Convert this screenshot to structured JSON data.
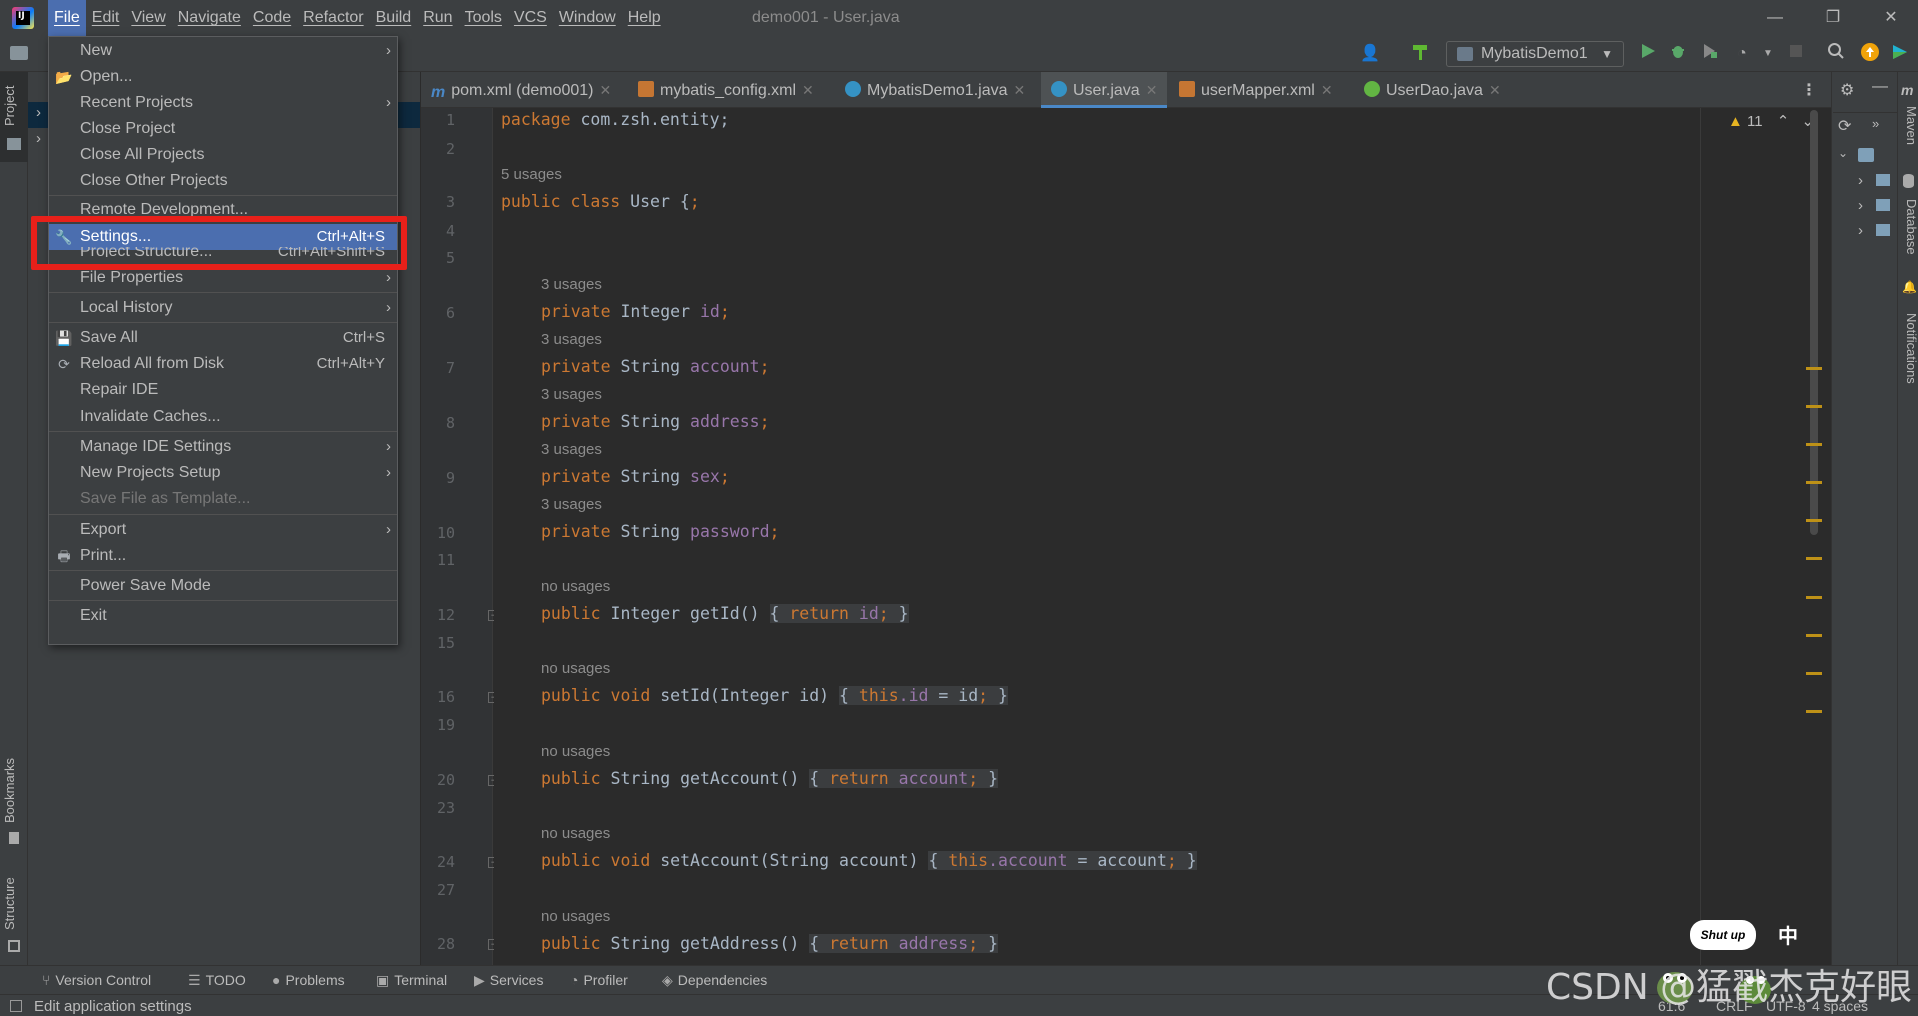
{
  "window": {
    "title": "demo001 - User.java",
    "minimize": "—",
    "maximize": "❐",
    "close": "✕"
  },
  "menubar": [
    "File",
    "Edit",
    "View",
    "Navigate",
    "Code",
    "Refactor",
    "Build",
    "Run",
    "Tools",
    "VCS",
    "Window",
    "Help"
  ],
  "toolbar": {
    "run_config": "MybatisDemo1"
  },
  "left_strip": {
    "project": "Project",
    "bookmarks": "Bookmarks",
    "structure": "Structure"
  },
  "right_strip": {
    "maven": "Maven",
    "database": "Database",
    "notifications": "Notifications"
  },
  "tabs": [
    {
      "label": "pom.xml (demo001)",
      "icon": "maven-icon"
    },
    {
      "label": "mybatis_config.xml",
      "icon": "xml-icon"
    },
    {
      "label": "MybatisDemo1.java",
      "icon": "class-icon"
    },
    {
      "label": "User.java",
      "icon": "class-icon",
      "active": true
    },
    {
      "label": "userMapper.xml",
      "icon": "xml-icon"
    },
    {
      "label": "UserDao.java",
      "icon": "interface-icon"
    }
  ],
  "editor": {
    "inspection_count": "11",
    "line_numbers": [
      "1",
      "2",
      "3",
      "4",
      "5",
      "6",
      "7",
      "8",
      "9",
      "10",
      "11",
      "12",
      "15",
      "16",
      "19",
      "20",
      "23",
      "24",
      "27",
      "28"
    ],
    "hints": {
      "class_usages": "5 usages",
      "field_usages": "3 usages",
      "no_usages": "no usages"
    },
    "code": {
      "package_kw": "package",
      "package_name": " com.zsh.entity;",
      "class_line_kw": "public class",
      "class_name": " User {",
      "private": "private",
      "f_id_type": " Integer ",
      "f_id": "id",
      "f_account_type": " String ",
      "f_account": "account",
      "f_address_type": " String ",
      "f_address": "address",
      "f_sex_type": " String ",
      "f_sex": "sex",
      "f_password_type": " String ",
      "f_password": "password",
      "semicolon": ";",
      "m1_kw": "public",
      "m1_type": " Integer ",
      "m1_name": "getId",
      "m1_params": "()",
      "m1_body_kw": "return",
      "m1_body_fld": " id",
      "m2_kw": "public void",
      "m2_name": " setId",
      "m2_params": "(Integer id)",
      "m2_this": "this",
      "m2_fld": ".id",
      "m2_rest": " = id",
      "m3_kw": "public",
      "m3_type": " String ",
      "m3_name": "getAccount",
      "m3_params": "()",
      "m3_body_kw": "return",
      "m3_body_fld": " account",
      "m4_kw": "public void",
      "m4_name": " setAccount",
      "m4_params": "(String account)",
      "m4_this": "this",
      "m4_fld": ".account",
      "m4_rest": " = account",
      "m5_kw": "public",
      "m5_type": " String ",
      "m5_name": "getAddress",
      "m5_params": "()",
      "m5_body_kw": "return",
      "m5_body_fld": " address"
    }
  },
  "file_menu": {
    "items": [
      {
        "label": "New",
        "submenu": true
      },
      {
        "label": "Open...",
        "icon": "folder-open-icon"
      },
      {
        "label": "Recent Projects",
        "submenu": true
      },
      {
        "label": "Close Project"
      },
      {
        "label": "Close All Projects"
      },
      {
        "label": "Close Other Projects"
      },
      {
        "label": "Remote Development..."
      },
      {
        "label": "Settings...",
        "shortcut": "Ctrl+Alt+S",
        "icon": "wrench-icon",
        "selected": true
      },
      {
        "label": "Project Structure...",
        "shortcut": "Ctrl+Alt+Shift+S",
        "icon": "folder-icon"
      },
      {
        "label": "File Properties",
        "submenu": true
      },
      {
        "label": "Local History",
        "submenu": true
      },
      {
        "label": "Save All",
        "shortcut": "Ctrl+S",
        "icon": "save-icon"
      },
      {
        "label": "Reload All from Disk",
        "shortcut": "Ctrl+Alt+Y",
        "icon": "reload-icon"
      },
      {
        "label": "Repair IDE"
      },
      {
        "label": "Invalidate Caches..."
      },
      {
        "label": "Manage IDE Settings",
        "submenu": true
      },
      {
        "label": "New Projects Setup",
        "submenu": true
      },
      {
        "label": "Save File as Template...",
        "disabled": true
      },
      {
        "label": "Export",
        "submenu": true
      },
      {
        "label": "Print...",
        "icon": "print-icon"
      },
      {
        "label": "Power Save Mode"
      },
      {
        "label": "Exit"
      }
    ]
  },
  "bottom_tools": [
    "Version Control",
    "TODO",
    "Problems",
    "Terminal",
    "Services",
    "Profiler",
    "Dependencies"
  ],
  "status": {
    "message": "Edit application settings",
    "position": "61:6",
    "line_sep": "CRLF",
    "encoding": "UTF-8",
    "indent": "4 spaces"
  },
  "overlay": {
    "watermark": "CSDN @猛戳杰克好眼",
    "speech": "Shut up",
    "ime": "中"
  },
  "colors": {
    "accent": "#4b6eaf",
    "highlight_box": "#e8201a",
    "keyword": "#cc7832",
    "field": "#9876aa",
    "method": "#ffc66d"
  }
}
